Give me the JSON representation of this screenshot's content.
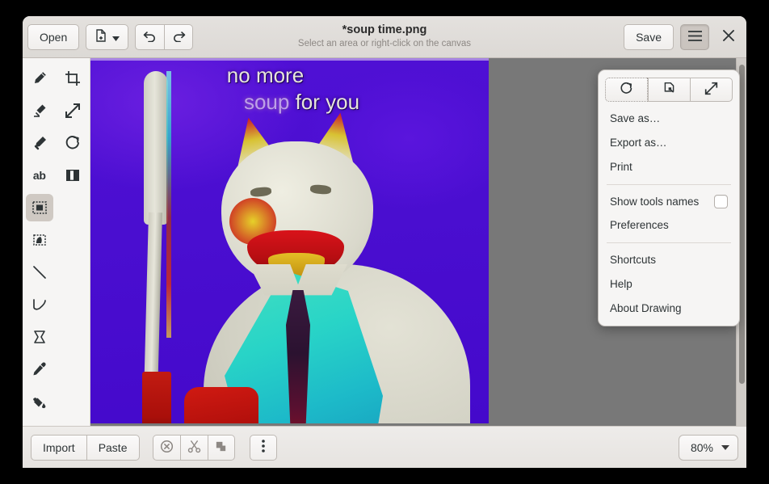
{
  "app": {
    "title": "*soup time.png",
    "subtitle": "Select an area or right-click on the canvas"
  },
  "header": {
    "open_label": "Open",
    "new_icon": "new-document-icon",
    "new_dropdown_icon": "chevron-down-icon",
    "undo_icon": "undo-icon",
    "redo_icon": "redo-icon",
    "save_label": "Save",
    "menu_icon": "hamburger-menu-icon",
    "close_icon": "close-icon"
  },
  "tools": [
    {
      "name": "pencil-tool",
      "icon": "pencil-icon",
      "active": false
    },
    {
      "name": "crop-tool",
      "icon": "crop-icon",
      "active": false
    },
    {
      "name": "eraser-tool",
      "icon": "eraser-icon",
      "active": false
    },
    {
      "name": "scale-tool",
      "icon": "scale-arrows-icon",
      "active": false
    },
    {
      "name": "highlighter-tool",
      "icon": "highlighter-icon",
      "active": false
    },
    {
      "name": "rotate-tool",
      "icon": "rotate-icon",
      "active": false
    },
    {
      "name": "text-tool",
      "icon": "ab-text-icon",
      "active": false
    },
    {
      "name": "filters-tool",
      "icon": "filter-icon",
      "active": false
    },
    {
      "name": "rectangle-select-tool",
      "icon": "rectangle-select-icon",
      "active": true
    },
    {
      "name": "free-select-tool",
      "icon": "free-select-icon",
      "active": false
    },
    {
      "name": "line-tool",
      "icon": "line-icon",
      "active": false
    },
    {
      "name": "curve-tool",
      "icon": "curve-icon",
      "active": false
    },
    {
      "name": "shape-tool",
      "icon": "polygon-icon",
      "active": false
    },
    {
      "name": "color-picker-tool",
      "icon": "eyedropper-icon",
      "active": false
    },
    {
      "name": "paint-bucket-tool",
      "icon": "paint-bucket-icon",
      "active": false
    }
  ],
  "menu": {
    "icon_buttons": [
      {
        "name": "rotate-button",
        "icon": "rotate-icon"
      },
      {
        "name": "crop-preview-button",
        "icon": "document-crop-icon"
      },
      {
        "name": "fullscreen-button",
        "icon": "expand-arrows-icon"
      }
    ],
    "items": [
      {
        "label": "Save as…",
        "name": "menu-save-as"
      },
      {
        "label": "Export as…",
        "name": "menu-export-as"
      },
      {
        "label": "Print",
        "name": "menu-print"
      }
    ],
    "items2": [
      {
        "label": "Show tools names",
        "name": "menu-show-tools-names",
        "checkbox": true,
        "checked": false
      },
      {
        "label": "Preferences",
        "name": "menu-preferences"
      }
    ],
    "items3": [
      {
        "label": "Shortcuts",
        "name": "menu-shortcuts"
      },
      {
        "label": "Help",
        "name": "menu-help"
      },
      {
        "label": "About Drawing",
        "name": "menu-about-drawing"
      }
    ]
  },
  "bottom": {
    "import_label": "Import",
    "paste_label": "Paste",
    "delete_icon": "delete-circle-icon",
    "cut_icon": "scissors-icon",
    "copy_icon": "copy-icon",
    "more_icon": "three-dots-icon",
    "zoom_level": "80%",
    "zoom_dropdown_icon": "chevron-down-icon"
  },
  "canvas": {
    "image_name": "soup time.png",
    "meme_line1": "no more",
    "meme_word_soup": "soup",
    "meme_line2_rest": "for you",
    "background_color": "#787878",
    "image_accent_color": "#4f0fd0"
  }
}
